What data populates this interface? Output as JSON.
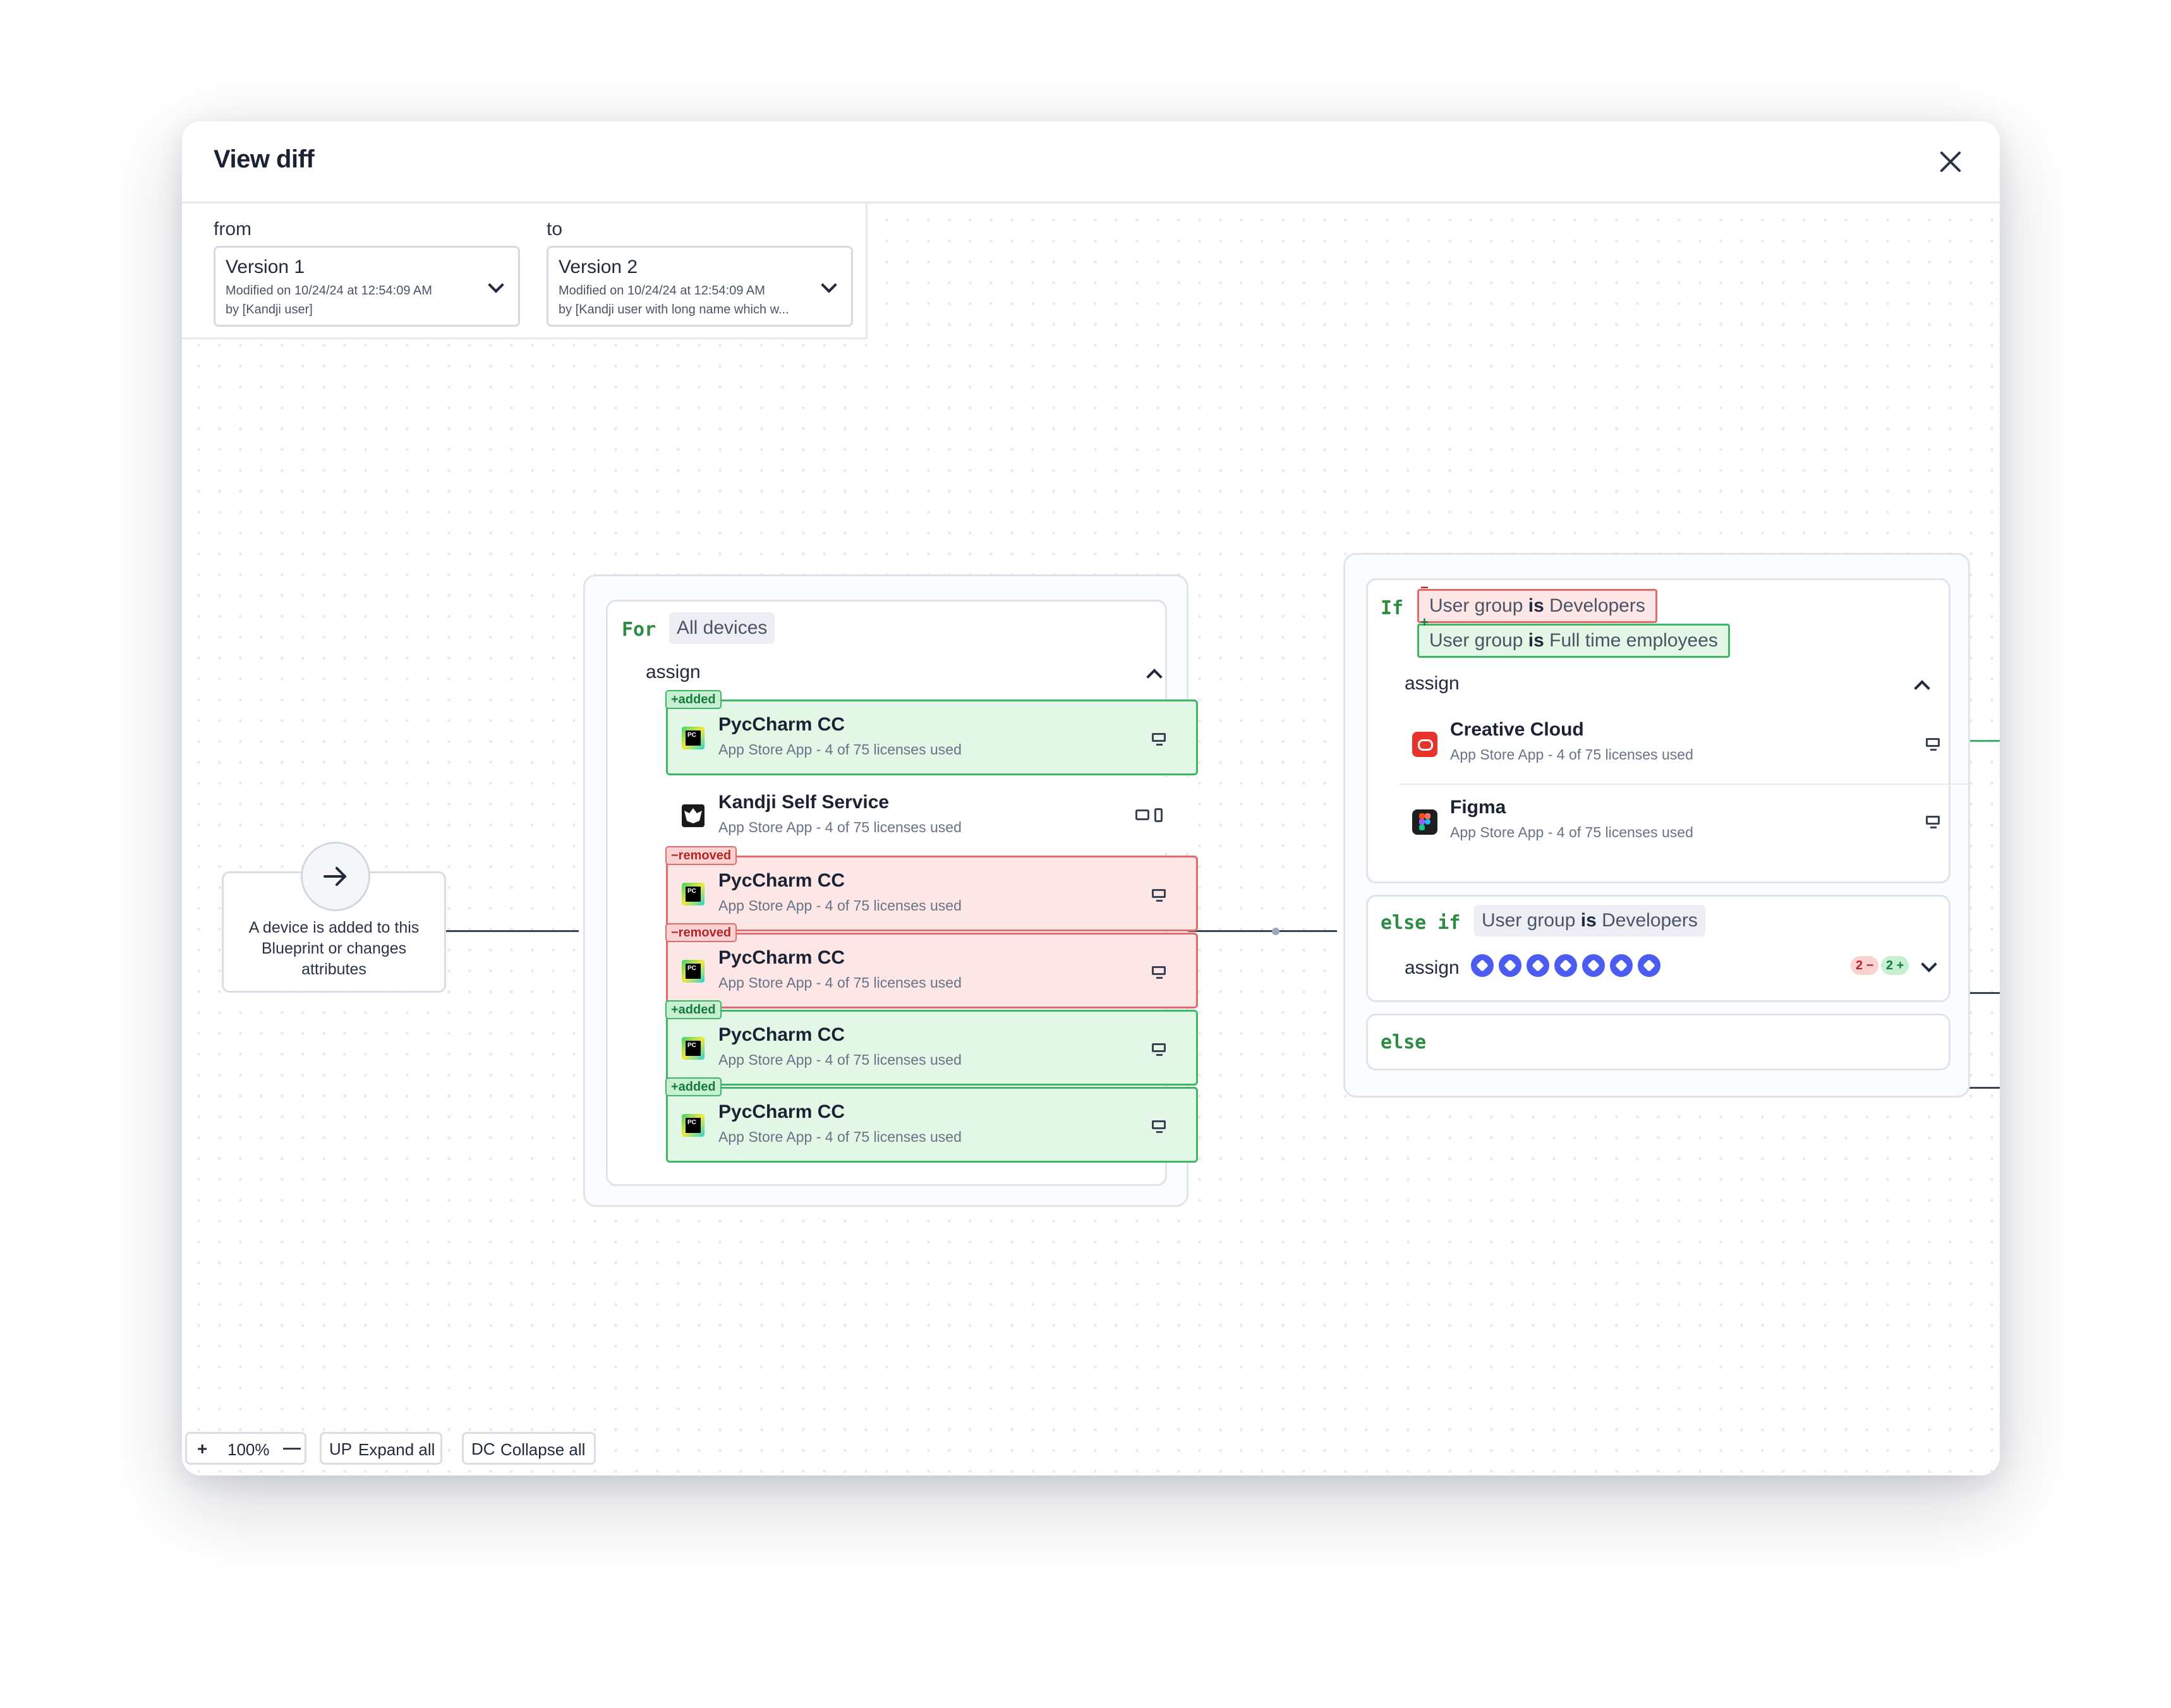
{
  "dialog": {
    "title": "View diff"
  },
  "versions": {
    "from_label": "from",
    "to_label": "to",
    "from": {
      "name": "Version 1",
      "modified": "Modified on 10/24/24 at 12:54:09 AM",
      "by": "by [Kandji user]"
    },
    "to": {
      "name": "Version 2",
      "modified": "Modified on 10/24/24 at 12:54:09 AM",
      "by": "by [Kandji user with long name which w..."
    }
  },
  "trigger": {
    "text": "A device is added to this Blueprint or changes attributes"
  },
  "for_block": {
    "keyword": "For",
    "target": "All devices",
    "assign_label": "assign",
    "apps": [
      {
        "status": "added",
        "badge": "+added",
        "name": "PycCharm CC",
        "subtitle": "App Store App - 4 of 75 licenses used",
        "device": "desktop-icon"
      },
      {
        "status": "unchanged",
        "badge": "",
        "name": "Kandji Self Service",
        "subtitle": "App Store App - 4 of 75 licenses used",
        "device": "tablet-phone-icon"
      },
      {
        "status": "removed",
        "badge": "−removed",
        "name": "PycCharm CC",
        "subtitle": "App Store App - 4 of 75 licenses used",
        "device": "desktop-icon"
      },
      {
        "status": "removed",
        "badge": "−removed",
        "name": "PycCharm CC",
        "subtitle": "App Store App - 4 of 75 licenses used",
        "device": "desktop-icon"
      },
      {
        "status": "added",
        "badge": "+added",
        "name": "PycCharm CC",
        "subtitle": "App Store App - 4 of 75 licenses used",
        "device": "desktop-icon"
      },
      {
        "status": "added",
        "badge": "+added",
        "name": "PycCharm CC",
        "subtitle": "App Store App - 4 of 75 licenses used",
        "device": "desktop-icon"
      }
    ]
  },
  "if_block": {
    "keyword": "If",
    "removed_condition": {
      "prefix": "User group ",
      "op": "is",
      "value": " Developers",
      "mark": "−"
    },
    "added_condition": {
      "prefix": "User group ",
      "op": "is",
      "value": " Full time employees",
      "mark": "+"
    },
    "assign_label": "assign",
    "apps": [
      {
        "name": "Creative Cloud",
        "subtitle": "App Store App - 4 of 75 licenses used",
        "icon": "creative-cloud-icon"
      },
      {
        "name": "Figma",
        "subtitle": "App Store App - 4 of 75 licenses used",
        "icon": "figma-icon"
      }
    ]
  },
  "else_if_block": {
    "keyword": "else if",
    "condition": {
      "prefix": "User group ",
      "op": "is",
      "value": " Developers"
    },
    "assign_label": "assign",
    "avatar_count": 7,
    "removed_count": "2 −",
    "added_count": "2 +"
  },
  "else_block": {
    "keyword": "else"
  },
  "toolbar": {
    "zoom_in": "+",
    "zoom_level": "100%",
    "zoom_out": "—",
    "expand_icon": "UP",
    "expand_label": "Expand all",
    "collapse_icon": "DC",
    "collapse_label": "Collapse all"
  },
  "colors": {
    "added": "#3fb566",
    "removed": "#e56b6b",
    "keyword": "#2e8b43",
    "avatar": "#4a5df0"
  }
}
